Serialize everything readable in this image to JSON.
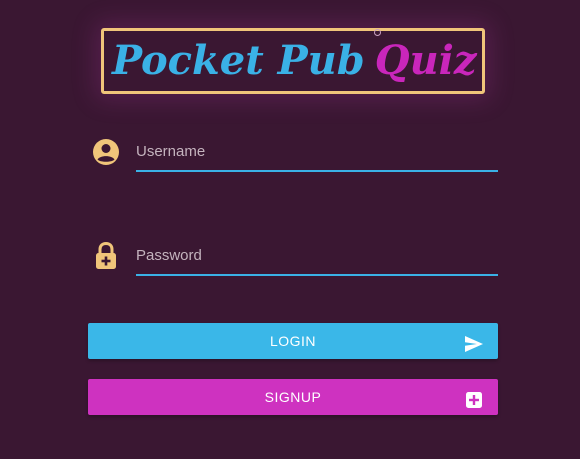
{
  "logo": {
    "word1": "Pocket Pub",
    "word2": "Quiz"
  },
  "username": {
    "placeholder": "Username",
    "icon": "account-circle-icon"
  },
  "password": {
    "placeholder": "Password",
    "icon": "lock-plus-icon"
  },
  "login_button": {
    "label": "LOGIN",
    "icon": "send-icon"
  },
  "signup_button": {
    "label": "SIGNUP",
    "icon": "plus-box-icon"
  },
  "colors": {
    "background": "#3a1732",
    "accent_blue": "#3ab7e8",
    "accent_magenta": "#ce32c0",
    "logo_frame": "#f0c57a",
    "icon_gold": "#f0c57a"
  }
}
